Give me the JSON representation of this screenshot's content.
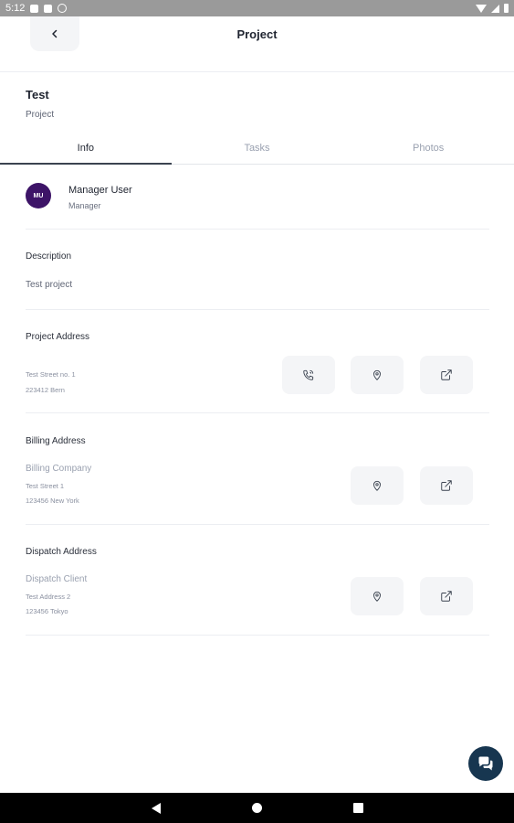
{
  "status_bar": {
    "time": "5:12"
  },
  "header": {
    "title": "Project"
  },
  "project": {
    "name": "Test",
    "type": "Project"
  },
  "tabs": [
    {
      "label": "Info",
      "active": true
    },
    {
      "label": "Tasks",
      "active": false
    },
    {
      "label": "Photos",
      "active": false
    }
  ],
  "manager": {
    "initials": "MU",
    "name": "Manager User",
    "role": "Manager",
    "avatar_color": "#3d1467"
  },
  "description": {
    "title": "Description",
    "text": "Test project"
  },
  "project_address": {
    "title": "Project Address",
    "line1": "Test Street no. 1",
    "line2": "223412 Bern"
  },
  "billing_address": {
    "title": "Billing Address",
    "company": "Billing Company",
    "line1": "Test Street 1",
    "line2": "123456 New York"
  },
  "dispatch_address": {
    "title": "Dispatch Address",
    "company": "Dispatch Client",
    "line1": "Test Address 2",
    "line2": "123456 Tokyo"
  },
  "icons": {
    "back": "chevron-left-icon",
    "phone": "phone-call-icon",
    "map": "map-pin-icon",
    "open": "external-link-icon",
    "chat": "chat-icon"
  },
  "colors": {
    "accent": "#173650",
    "tab_indicator": "#3b4350"
  }
}
